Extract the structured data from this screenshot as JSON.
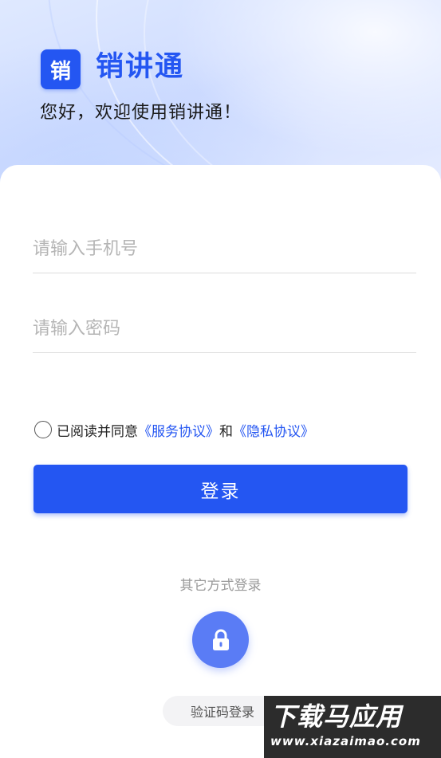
{
  "header": {
    "logo_char": "销",
    "app_title": "销讲通",
    "welcome": "您好，欢迎使用销讲通！"
  },
  "form": {
    "phone_placeholder": "请输入手机号",
    "password_placeholder": "请输入密码",
    "agreement": {
      "prefix": "已阅读并同意",
      "service_link": "《服务协议》",
      "conjunction": "和",
      "privacy_link": "《隐私协议》",
      "checked": false
    },
    "login_label": "登录"
  },
  "other_login": {
    "label": "其它方式登录",
    "lock_icon": "lock-icon",
    "code_login_label": "验证码登录"
  },
  "watermark": {
    "main": "下载马应用",
    "sub": "www.xiazaimao.com"
  },
  "colors": {
    "accent": "#2456f2",
    "lock_button": "#5a7cf5",
    "placeholder": "#b5b5b5"
  }
}
